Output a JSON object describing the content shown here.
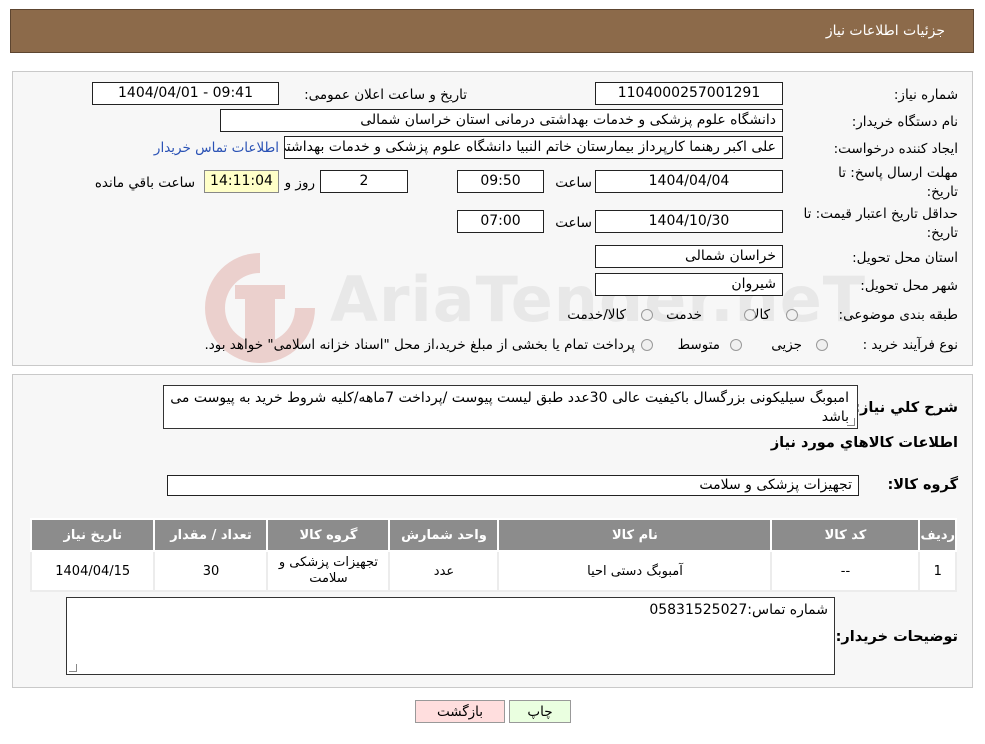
{
  "page_title": "جزئیات اطلاعات نیاز",
  "labels": {
    "need_number": "شماره نیاز:",
    "announce_datetime": "تاریخ و ساعت اعلان عمومی:",
    "buyer_org": "نام دستگاه خريدار:",
    "requester": "ایجاد کننده درخواست:",
    "send_deadline": "مهلت ارسال پاسخ: تا تاریخ:",
    "time_word": "ساعت",
    "days_word": "روز و",
    "remaining_word": "ساعت باقي مانده",
    "price_validity": "حداقل تاریخ اعتبار قیمت: تا تاریخ:",
    "delivery_province": "استان محل تحویل:",
    "delivery_city": "شهر محل تحویل:",
    "category": "طبقه بندی موضوعی:",
    "purchase_process": "نوع فرآیند خرید :",
    "description": "شرح کلي نياز:",
    "goods_info": "اطلاعات کالاهاي مورد نياز",
    "goods_group": "گروه کالا:",
    "buyer_notes": "توضیحات خریدار:"
  },
  "values": {
    "need_number": "1104000257001291",
    "announce_datetime": "1404/04/01 - 09:41",
    "buyer_org": "دانشگاه علوم پزشکی و خدمات بهداشتی درمانی استان خراسان شمالی",
    "requester": "علی اکبر رهنما کارپرداز بیمارستان خاتم النبیا دانشگاه علوم پزشکی و خدمات بهداشتی درمانی استان خراسان شمالی",
    "contact_link": "اطلاعات تماس خریدار",
    "send_date": "1404/04/04",
    "send_time": "09:50",
    "days_remaining": "2",
    "time_remaining": "14:11:04",
    "validity_date": "1404/10/30",
    "validity_time": "07:00",
    "province": "خراسان شمالی",
    "city": "شیروان",
    "category_options": [
      "کالا",
      "خدمت",
      "کالا/خدمت"
    ],
    "process_options": [
      "جزیی",
      "متوسط"
    ],
    "process_note": "پرداخت تمام یا بخشی از مبلغ خرید،از محل \"اسناد خزانه اسلامی\" خواهد بود.",
    "description": "امبوبگ سیلیکونی بزرگسال باکیفیت عالی 30عدد طبق لیست پیوست /پرداخت 7ماهه/کلیه شروط خرید به پیوست می باشد",
    "goods_group": "تجهیزات پزشکی و سلامت",
    "buyer_notes": "شماره تماس:05831525027"
  },
  "table": {
    "headers": [
      "ردیف",
      "کد کالا",
      "نام کالا",
      "واحد شمارش",
      "گروه کالا",
      "تعداد / مقدار",
      "تاریخ نیاز"
    ],
    "rows": [
      [
        "1",
        "--",
        "آمبوبگ دستی احیا",
        "عدد",
        "تجهیزات پزشکی و سلامت",
        "30",
        "1404/04/15"
      ]
    ]
  },
  "buttons": {
    "print": "چاپ",
    "back": "بازگشت"
  },
  "watermark": "AriaTender.neT",
  "colors": {
    "title_bar": "#8c6a4a",
    "link": "#2a52b5",
    "time_highlight": "#ffffc8",
    "print_button": "#eaffe0",
    "back_button": "#ffdede"
  }
}
